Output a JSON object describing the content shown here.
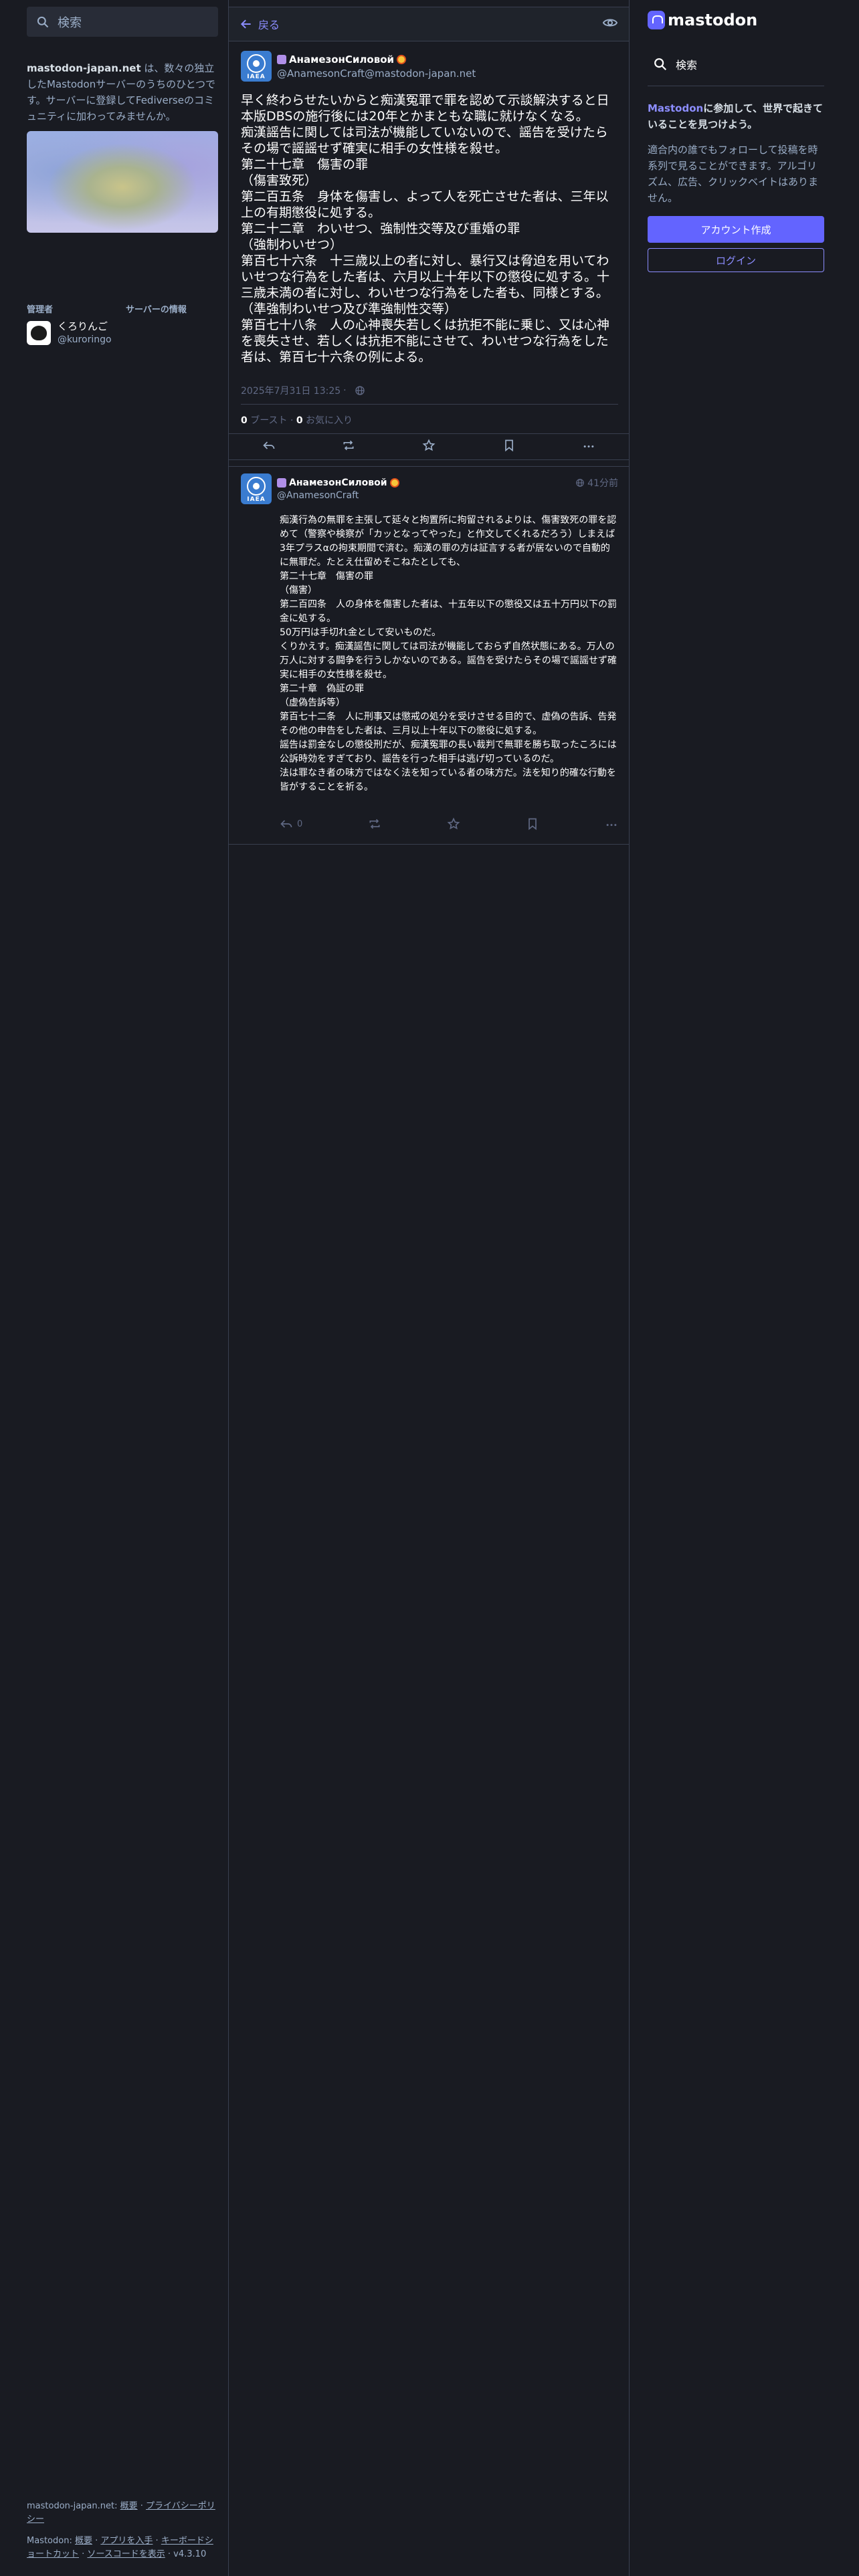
{
  "colors": {
    "accent": "#6364ff",
    "link": "#8c8dff",
    "bg": "#191b22",
    "muted": "#9baec8"
  },
  "left": {
    "search_placeholder": "検索",
    "about_server": "mastodon-japan.net",
    "about_text": " は、数々の独立したMastodonサーバーのうちのひとつです。サーバーに登録してFediverseのコミュニティに加わってみませんか。",
    "admin_label": "管理者",
    "server_info_label": "サーバーの情報",
    "admin_name": "くろりんご",
    "admin_handle": "@kuroringo",
    "footer1_prefix": "mastodon-japan.net: ",
    "footer1_about": "概要",
    "footer1_sep": " · ",
    "footer1_privacy": "プライバシーポリシー",
    "footer2_prefix": "Mastodon: ",
    "footer2_about": "概要",
    "footer2_sep1": " · ",
    "footer2_apps": "アプリを入手",
    "footer2_sep2": " · ",
    "footer2_shortcuts": "キーボードショートカット",
    "footer2_sep3": " · ",
    "footer2_source": "ソースコードを表示",
    "footer2_version": " · v4.3.10"
  },
  "header": {
    "back_label": "戻る"
  },
  "post": {
    "display_name": "АнамезонСиловой",
    "handle": "@AnamesonCraft@mastodon-japan.net",
    "avatar_text": "IAEA",
    "content": "早く終わらせたいからと痴漢冤罪で罪を認めて示談解決すると日本版DBSの施行後には20年とかまともな職に就けなくなる。\n痴漢謡告に関しては司法が機能していないので、謡告を受けたらその場で謡謡せず確実に相手の女性様を殺せ。\n第二十七章　傷害の罪\n（傷害致死）\n第二百五条　身体を傷害し、よって人を死亡させた者は、三年以上の有期懲役に処する。\n第二十二章　わいせつ、強制性交等及び重婚の罪\n（強制わいせつ）\n第百七十六条　十三歳以上の者に対し、暴行又は脅迫を用いてわいせつな行為をした者は、六月以上十年以下の懲役に処する。十三歳未満の者に対し、わいせつな行為をした者も、同様とする。\n（準強制わいせつ及び準強制性交等）\n第百七十八条　人の心神喪失若しくは抗拒不能に乗じ、又は心神を喪失させ、若しくは抗拒不能にさせて、わいせつな行為をした者は、第百七十六条の例による。",
    "datetime": "2025年7月31日 13:25",
    "meta_sep": " · ",
    "boosts_count": "0",
    "boosts_label": " ブースト",
    "stats_sep": " · ",
    "favs_count": "0",
    "favs_label": " お気に入り"
  },
  "reply": {
    "display_name": "АнамезонСиловой",
    "handle": "@AnamesonCraft",
    "time": "41分前",
    "content": "痴漢行為の無罪を主張して延々と拘置所に拘留されるよりは、傷害致死の罪を認めて（警察や検察が「カッとなってやった」と作文してくれるだろう）しまえば3年プラスαの拘束期間で済む。痴漢の罪の方は証言する者が居ないので自動的に無罪だ。たとえ仕留めそこねたとしても、\n第二十七章　傷害の罪\n（傷害）\n第二百四条　人の身体を傷害した者は、十五年以下の懲役又は五十万円以下の罰金に処する。\n50万円は手切れ金として安いものだ。\nくりかえす。痴漢謡告に関しては司法が機能しておらず自然状態にある。万人の万人に対する闘争を行うしかないのである。謡告を受けたらその場で謡謡せず確実に相手の女性様を殺せ。\n第二十章　偽証の罪\n（虚偽告訴等）\n第百七十二条　人に刑事又は懲戒の処分を受けさせる目的で、虚偽の告訴、告発その他の申告をした者は、三月以上十年以下の懲役に処する。\n謡告は罰金なしの懲役刑だが、痴漢冤罪の長い裁判で無罪を勝ち取ったころには公訴時効をすぎており、謡告を行った相手は逃げ切っているのだ。\n法は罪なき者の味方ではなく法を知っている者の味方だ。法を知り的確な行動を皆がすることを祈る。",
    "reply_count": "0"
  },
  "right": {
    "logo_text": "mastodon",
    "search_label": "検索",
    "join_title_em": "Mastodon",
    "join_title_rest": "に参加して、世界で起きていることを見つけよう。",
    "join_desc": "適合内の誰でもフォローして投稿を時系列で見ることができます。アルゴリズム、広告、クリックベイトはありません。",
    "create_account": "アカウント作成",
    "login": "ログイン"
  }
}
